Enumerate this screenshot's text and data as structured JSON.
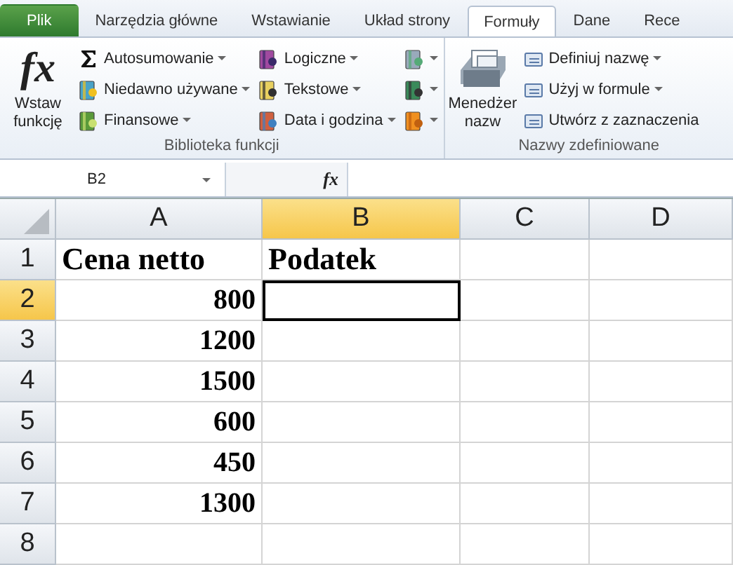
{
  "tabs": [
    {
      "label": "Plik",
      "kind": "file",
      "selected": false
    },
    {
      "label": "Narzędzia główne",
      "kind": "tab",
      "selected": false
    },
    {
      "label": "Wstawianie",
      "kind": "tab",
      "selected": false
    },
    {
      "label": "Układ strony",
      "kind": "tab",
      "selected": false
    },
    {
      "label": "Formuły",
      "kind": "tab",
      "selected": true
    },
    {
      "label": "Dane",
      "kind": "tab",
      "selected": false
    },
    {
      "label": "Rece",
      "kind": "tab",
      "selected": false
    }
  ],
  "ribbon": {
    "groups": [
      {
        "label": "Biblioteka funkcji",
        "large_button": {
          "label": "Wstaw funkcję",
          "glyph": "fx",
          "kind": "fx"
        },
        "columns": [
          [
            {
              "label": "Autosumowanie",
              "dropdown": true
            },
            {
              "label": "Niedawno używane",
              "dropdown": true
            },
            {
              "label": "Finansowe",
              "dropdown": true
            }
          ],
          [
            {
              "label": "Logiczne",
              "dropdown": true
            },
            {
              "label": "Tekstowe",
              "dropdown": true
            },
            {
              "label": "Data i godzina",
              "dropdown": true
            }
          ],
          [
            {
              "dropdown": true
            },
            {
              "dropdown": true
            },
            {
              "dropdown": true
            }
          ]
        ]
      },
      {
        "label": "Nazwy zdefiniowane",
        "large_button": {
          "label": "Menedżer nazw",
          "kind": "manager"
        },
        "columns": [
          [
            {
              "label": "Definiuj nazwę",
              "dropdown": true
            },
            {
              "label": "Użyj w formule",
              "dropdown": true
            },
            {
              "label": "Utwórz z zaznaczenia",
              "dropdown": false
            }
          ]
        ]
      }
    ]
  },
  "formula_bar": {
    "name_box": "B2",
    "fx": "fx"
  },
  "sheet": {
    "columns": [
      {
        "label": "A",
        "selected": false
      },
      {
        "label": "B",
        "selected": true
      },
      {
        "label": "C",
        "selected": false
      },
      {
        "label": "D",
        "selected": false
      }
    ],
    "rows": [
      {
        "label": "1",
        "selected": false,
        "cells": [
          {
            "text": "Cena netto",
            "kind": "heading"
          },
          {
            "text": "Podatek",
            "kind": "heading"
          },
          {},
          {}
        ]
      },
      {
        "label": "2",
        "selected": true,
        "cells": [
          {
            "text": "800",
            "kind": "number"
          },
          {
            "selected": true
          },
          {},
          {}
        ]
      },
      {
        "label": "3",
        "selected": false,
        "cells": [
          {
            "text": "1200",
            "kind": "number"
          },
          {},
          {},
          {}
        ]
      },
      {
        "label": "4",
        "selected": false,
        "cells": [
          {
            "text": "1500",
            "kind": "number"
          },
          {},
          {},
          {}
        ]
      },
      {
        "label": "5",
        "selected": false,
        "cells": [
          {
            "text": "600",
            "kind": "number"
          },
          {},
          {},
          {}
        ]
      },
      {
        "label": "6",
        "selected": false,
        "cells": [
          {
            "text": "450",
            "kind": "number"
          },
          {},
          {},
          {}
        ]
      },
      {
        "label": "7",
        "selected": false,
        "cells": [
          {
            "text": "1300",
            "kind": "number"
          },
          {},
          {},
          {}
        ]
      },
      {
        "label": "8",
        "selected": false,
        "cells": [
          {},
          {},
          {},
          {}
        ]
      }
    ]
  }
}
